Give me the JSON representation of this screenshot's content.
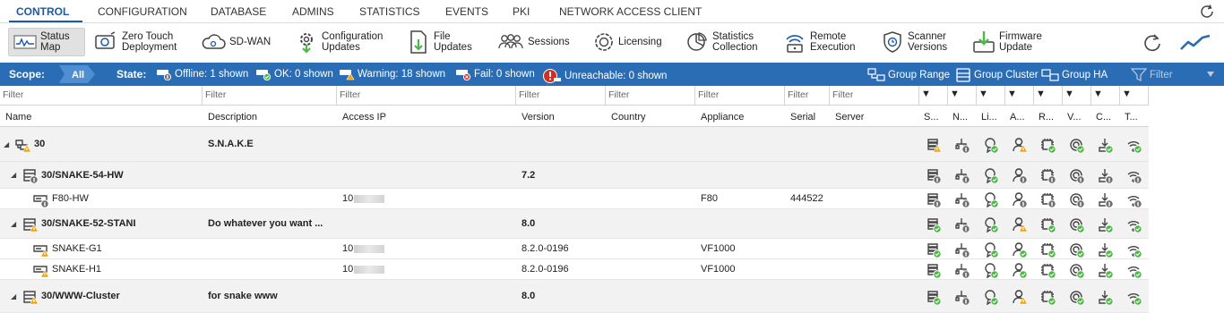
{
  "menu": [
    "CONTROL",
    "CONFIGURATION",
    "DATABASE",
    "ADMINS",
    "STATISTICS",
    "EVENTS",
    "PKI",
    "NETWORK ACCESS CLIENT"
  ],
  "toolbar": {
    "status_map": "Status\nMap",
    "zero_touch": "Zero Touch\nDeployment",
    "sdwan": "SD-WAN",
    "config_updates": "Configuration\nUpdates",
    "file_updates": "File\nUpdates",
    "sessions": "Sessions",
    "licensing": "Licensing",
    "stats_collection": "Statistics\nCollection",
    "remote_exec": "Remote\nExecution",
    "scanner_versions": "Scanner\nVersions",
    "firmware_update": "Firmware\nUpdate"
  },
  "scope": {
    "label": "Scope:",
    "all": "All",
    "state_label": "State:",
    "offline": "Offline: 1 shown",
    "ok": "OK: 0 shown",
    "warning": "Warning: 18 shown",
    "fail": "Fail: 0 shown",
    "unreachable": "Unreachable: 0 shown",
    "group_range": "Group Range",
    "group_cluster": "Group Cluster",
    "group_ha": "Group HA",
    "filter": "Filter"
  },
  "filter_placeholder": "Filter",
  "filter_small": "▼",
  "columns": {
    "name": "Name",
    "description": "Description",
    "access_ip": "Access IP",
    "version": "Version",
    "country": "Country",
    "appliance": "Appliance",
    "serial": "Serial",
    "server": "Server",
    "s": "S...",
    "n": "N...",
    "li": "Li...",
    "a": "A...",
    "r": "R...",
    "v": "V...",
    "c": "C...",
    "t": "T..."
  },
  "rows": [
    {
      "name": "30",
      "description": "S.N.A.K.E",
      "ip": "",
      "version": "",
      "appliance": "",
      "serial": ""
    },
    {
      "name": "30/SNAKE-54-HW",
      "description": "",
      "ip": "",
      "version": "7.2",
      "appliance": "",
      "serial": ""
    },
    {
      "name": "F80-HW",
      "description": "",
      "ip": "10",
      "version": "",
      "appliance": "F80",
      "serial": "444522"
    },
    {
      "name": "30/SNAKE-52-STANI",
      "description": "Do whatever you want ...",
      "ip": "",
      "version": "8.0",
      "appliance": "",
      "serial": ""
    },
    {
      "name": "SNAKE-G1",
      "description": "",
      "ip": "10",
      "version": "8.2.0-0196",
      "appliance": "VF1000",
      "serial": ""
    },
    {
      "name": "SNAKE-H1",
      "description": "",
      "ip": "10",
      "version": "8.2.0-0196",
      "appliance": "VF1000",
      "serial": ""
    },
    {
      "name": "30/WWW-Cluster",
      "description": "for snake www",
      "ip": "",
      "version": "8.0",
      "appliance": "",
      "serial": ""
    }
  ],
  "colors": {
    "accent": "#1a5aa8",
    "scopebar": "#2a6db4",
    "ok": "#4cb848",
    "warning": "#f0a30a",
    "info": "#6e6e6e",
    "fail": "#d62d20"
  }
}
